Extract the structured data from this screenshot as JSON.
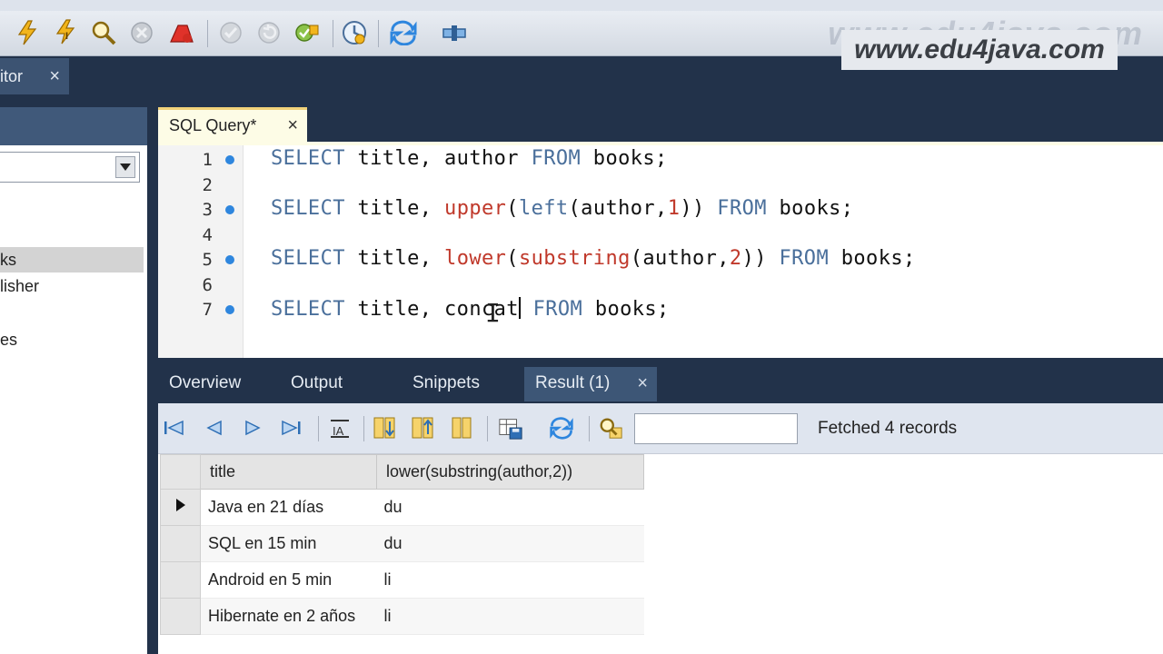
{
  "watermark": {
    "text": "www.edu4java.com"
  },
  "editor_tab": {
    "label": "itor",
    "close": "×"
  },
  "left_panel": {
    "items": [
      {
        "label": "ks",
        "selected": true
      },
      {
        "label": "lisher",
        "selected": false
      },
      {
        "label": "es",
        "selected": false
      }
    ]
  },
  "query_tab": {
    "label": "SQL Query*",
    "close": "×"
  },
  "code_lines": [
    {
      "n": "1",
      "bp": true
    },
    {
      "n": "2",
      "bp": false
    },
    {
      "n": "3",
      "bp": true
    },
    {
      "n": "4",
      "bp": false
    },
    {
      "n": "5",
      "bp": true
    },
    {
      "n": "6",
      "bp": false
    },
    {
      "n": "7",
      "bp": true
    }
  ],
  "code": {
    "line1": {
      "kw1": "SELECT",
      "t1": " title, author ",
      "kw2": "FROM",
      "t2": " books;"
    },
    "line3": {
      "kw1": "SELECT",
      "t1": " title, ",
      "fn1": "upper",
      "t2": "(",
      "fn2": "left",
      "t3": "(author,",
      "n1": "1",
      "t4": ")) ",
      "kw2": "FROM",
      "t5": " books;"
    },
    "line5": {
      "kw1": "SELECT",
      "t1": " title, ",
      "fn1": "lower",
      "t2": "(",
      "fn2": "substring",
      "t3": "(author,",
      "n1": "2",
      "t4": ")) ",
      "kw2": "FROM",
      "t5": " books;"
    },
    "line7": {
      "kw1": "SELECT",
      "t1": " title, concat",
      "kw2": "FROM",
      "t2": " books;"
    }
  },
  "bottom_tabs": {
    "overview": "Overview",
    "output": "Output",
    "snippets": "Snippets",
    "result": "Result (1)",
    "result_close": "×"
  },
  "result_toolbar": {
    "status": "Fetched 4 records",
    "search_value": ""
  },
  "grid": {
    "columns": [
      "title",
      "lower(substring(author,2))"
    ],
    "rows": [
      {
        "title": "Java en 21 días",
        "value": "du",
        "current": true
      },
      {
        "title": "SQL en 15 min",
        "value": "du",
        "current": false
      },
      {
        "title": "Android en 5 min",
        "value": "li",
        "current": false
      },
      {
        "title": "Hibernate en 2 años",
        "value": "li",
        "current": false
      }
    ]
  },
  "colors": {
    "keyword": "#4a6f9b",
    "function": "#c0392b",
    "breakpoint": "#2e86de",
    "dark_bg": "#22324a",
    "tab_accent": "#f1d27a"
  }
}
